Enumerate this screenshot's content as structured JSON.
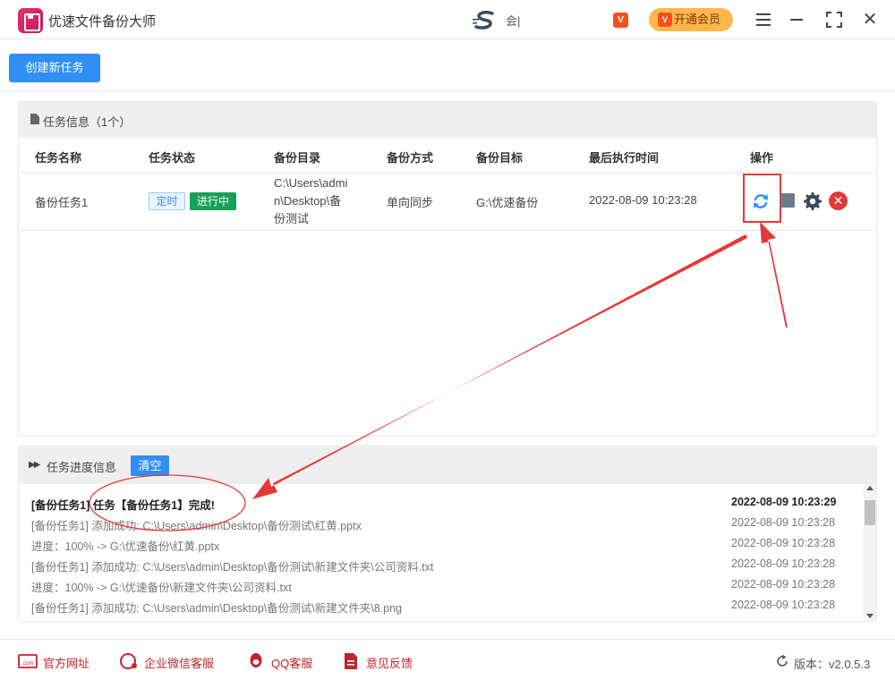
{
  "app": {
    "title": "优速文件备份大师"
  },
  "user": {
    "name": "会|"
  },
  "vip": {
    "badge": "V",
    "button_icon": "V",
    "button_label": "开通会员"
  },
  "window": {
    "close_glyph": "✕"
  },
  "toolbar": {
    "create_task_label": "创建新任务"
  },
  "task_panel": {
    "title": "任务信息（1个）",
    "columns": [
      "任务名称",
      "任务状态",
      "备份目录",
      "备份方式",
      "备份目标",
      "最后执行时间",
      "操作"
    ],
    "rows": [
      {
        "name": "备份任务1",
        "tags": [
          "定时",
          "进行中"
        ],
        "source_lines": [
          "C:\\Users\\admi",
          "n\\Desktop\\备",
          "份测试"
        ],
        "mode": "单向同步",
        "target": "G:\\优速备份",
        "last_run": "2022-08-09 10:23:28",
        "delete_glyph": "✕"
      }
    ]
  },
  "progress_panel": {
    "title": "任务进度信息",
    "clear_label": "清空",
    "logs": [
      {
        "message": "[备份任务1] 任务【备份任务1】完成!",
        "time": "2022-08-09 10:23:29",
        "bold": true
      },
      {
        "message": "[备份任务1] 添加成功:   C:\\Users\\admin\\Desktop\\备份测试\\红黄.pptx",
        "time": "2022-08-09 10:23:28",
        "bold": false
      },
      {
        "message": "进度：100% -> G:\\优速备份\\红黄.pptx",
        "time": "2022-08-09 10:23:28",
        "bold": false
      },
      {
        "message": "[备份任务1] 添加成功:   C:\\Users\\admin\\Desktop\\备份测试\\新建文件夹\\公司资料.txt",
        "time": "2022-08-09 10:23:28",
        "bold": false
      },
      {
        "message": "进度：100% -> G:\\优速备份\\新建文件夹\\公司资料.txt",
        "time": "2022-08-09 10:23:28",
        "bold": false
      },
      {
        "message": "[备份任务1] 添加成功:   C:\\Users\\admin\\Desktop\\备份测试\\新建文件夹\\8.png",
        "time": "2022-08-09 10:23:28",
        "bold": false
      }
    ]
  },
  "footer": {
    "links": [
      {
        "label": "官方网址",
        "icon": "website-icon"
      },
      {
        "label": "企业微信客服",
        "icon": "wechat-work-icon"
      },
      {
        "label": "QQ客服",
        "icon": "qq-icon"
      },
      {
        "label": "意见反馈",
        "icon": "feedback-icon"
      }
    ],
    "version": "版本：v2.0.5.3"
  },
  "colors": {
    "primary": "#2f8ff2",
    "annotation_red": "#e53935",
    "running_green": "#18a058",
    "vip_orange": "#ffb74d"
  }
}
